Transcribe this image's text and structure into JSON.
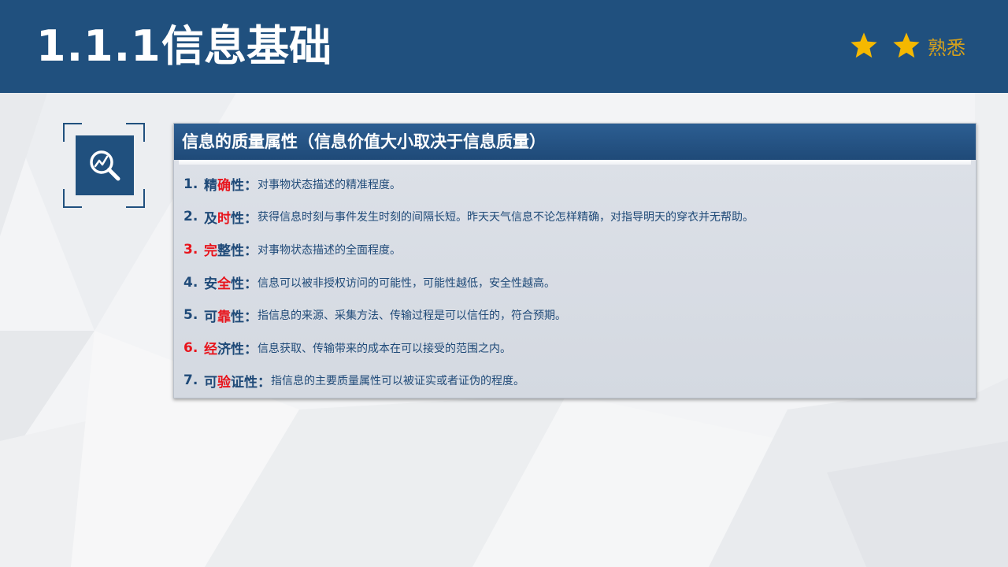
{
  "header": {
    "section_number": "1.1.1",
    "title": "信息基础",
    "stars": 2,
    "level_text": "熟悉",
    "bg_color": "#20507e",
    "star_color": "#f5b800"
  },
  "icon": {
    "name": "magnifier-chart-icon"
  },
  "panel": {
    "title": "信息的质量属性（信息价值大小取决于信息质量）",
    "items": [
      {
        "num": "1.",
        "num_color": "blue",
        "name_parts": [
          {
            "t": "精",
            "red": false
          },
          {
            "t": "确",
            "red": true
          },
          {
            "t": "性",
            "red": false
          }
        ],
        "colon": "：",
        "desc": "对事物状态描述的精准程度。"
      },
      {
        "num": "2.",
        "num_color": "blue",
        "name_parts": [
          {
            "t": "及",
            "red": false
          },
          {
            "t": "时",
            "red": true
          },
          {
            "t": "性",
            "red": false
          }
        ],
        "colon": "：",
        "desc": "获得信息时刻与事件发生时刻的间隔长短。昨天天气信息不论怎样精确，对指导明天的穿衣并无帮助。"
      },
      {
        "num": "3.",
        "num_color": "red",
        "name_parts": [
          {
            "t": "完",
            "red": true
          },
          {
            "t": "整性",
            "red": false
          }
        ],
        "colon": "：",
        "desc": "对事物状态描述的全面程度。"
      },
      {
        "num": "4.",
        "num_color": "blue",
        "name_parts": [
          {
            "t": "安",
            "red": false
          },
          {
            "t": "全",
            "red": true
          },
          {
            "t": "性",
            "red": false
          }
        ],
        "colon": "：",
        "desc": "信息可以被非授权访问的可能性，可能性越低，安全性越高。"
      },
      {
        "num": "5.",
        "num_color": "blue",
        "name_parts": [
          {
            "t": "可",
            "red": false
          },
          {
            "t": "靠",
            "red": true
          },
          {
            "t": "性",
            "red": false
          }
        ],
        "colon": "：",
        "desc": "指信息的来源、采集方法、传输过程是可以信任的，符合预期。"
      },
      {
        "num": "6.",
        "num_color": "red",
        "name_parts": [
          {
            "t": "经",
            "red": true
          },
          {
            "t": "济性",
            "red": false
          }
        ],
        "colon": "：",
        "desc": "信息获取、传输带来的成本在可以接受的范围之内。"
      },
      {
        "num": "7.",
        "num_color": "blue",
        "name_parts": [
          {
            "t": "可",
            "red": false
          },
          {
            "t": "验",
            "red": true
          },
          {
            "t": "证性",
            "red": false
          }
        ],
        "colon": "：",
        "desc": "指信息的主要质量属性可以被证实或者证伪的程度。"
      }
    ]
  }
}
